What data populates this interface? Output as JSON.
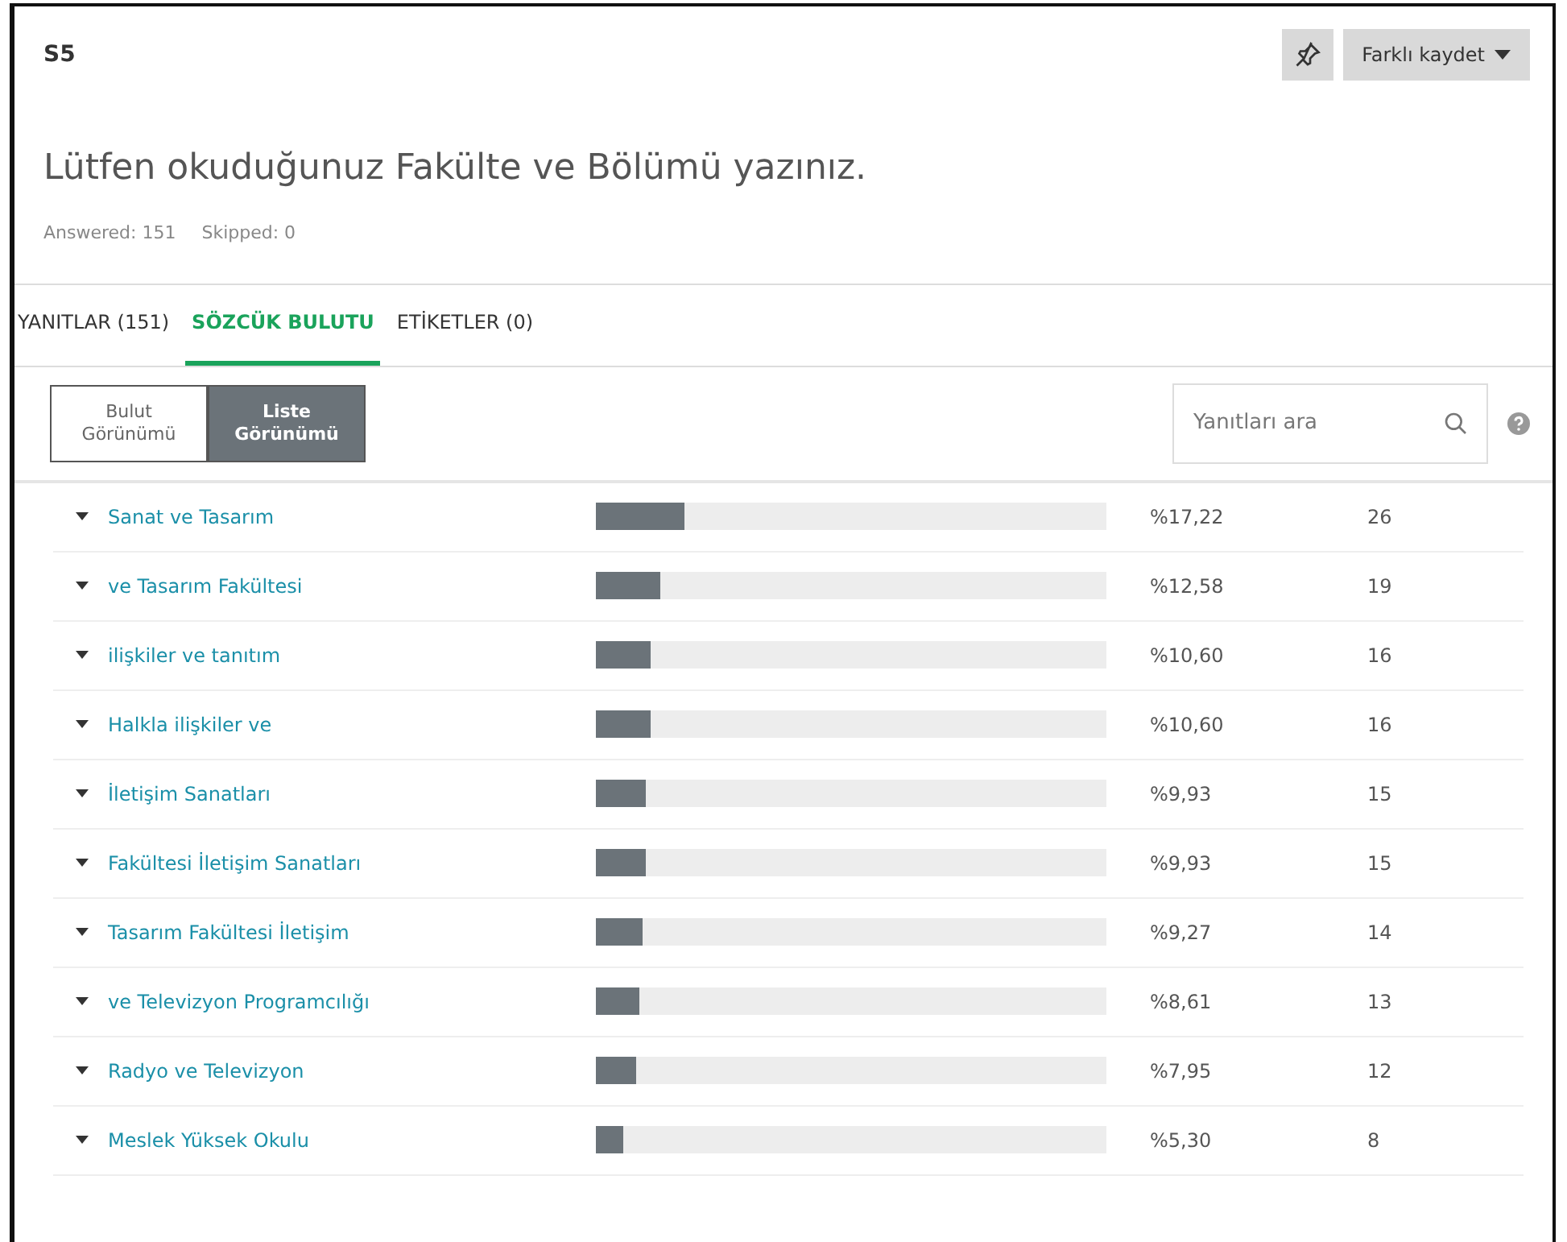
{
  "question_id": "S5",
  "save_as": {
    "label": "Farklı kaydet"
  },
  "question": "Lütfen okuduğunuz Fakülte ve Bölümü yazınız.",
  "stats": [
    "Answered: 151",
    "Skipped: 0"
  ],
  "tabs": [
    {
      "label": "YANITLAR (151)",
      "selected": false
    },
    {
      "label": "SÖZCÜK BULUTU",
      "selected": true
    },
    {
      "label": "ETİKETLER (0)",
      "selected": false
    }
  ],
  "view_toggle": [
    {
      "line1": "Bulut",
      "line2": "Görünümü",
      "selected": false
    },
    {
      "line1": "Liste",
      "line2": "Görünümü",
      "selected": true
    }
  ],
  "search": {
    "placeholder": "Yanıtları ara"
  },
  "rows": [
    {
      "phrase": "Sanat ve Tasarım",
      "level": 0.1722,
      "percent": "%17,22",
      "count": "26"
    },
    {
      "phrase": "ve Tasarım Fakültesi",
      "level": 0.1258,
      "percent": "%12,58",
      "count": "19"
    },
    {
      "phrase": "ilişkiler ve tanıtım",
      "level": 0.106,
      "percent": "%10,60",
      "count": "16"
    },
    {
      "phrase": "Halkla ilişkiler ve",
      "level": 0.106,
      "percent": "%10,60",
      "count": "16"
    },
    {
      "phrase": "İletişim Sanatları",
      "level": 0.0993,
      "percent": "%9,93",
      "count": "15"
    },
    {
      "phrase": "Fakültesi İletişim Sanatları",
      "level": 0.0993,
      "percent": "%9,93",
      "count": "15"
    },
    {
      "phrase": "Tasarım Fakültesi İletişim",
      "level": 0.0927,
      "percent": "%9,27",
      "count": "14"
    },
    {
      "phrase": "ve Televizyon Programcılığı",
      "level": 0.0861,
      "percent": "%8,61",
      "count": "13"
    },
    {
      "phrase": "Radyo ve Televizyon",
      "level": 0.0795,
      "percent": "%7,95",
      "count": "12"
    },
    {
      "phrase": "Meslek Yüksek Okulu",
      "level": 0.053,
      "percent": "%5,30",
      "count": "8"
    }
  ]
}
